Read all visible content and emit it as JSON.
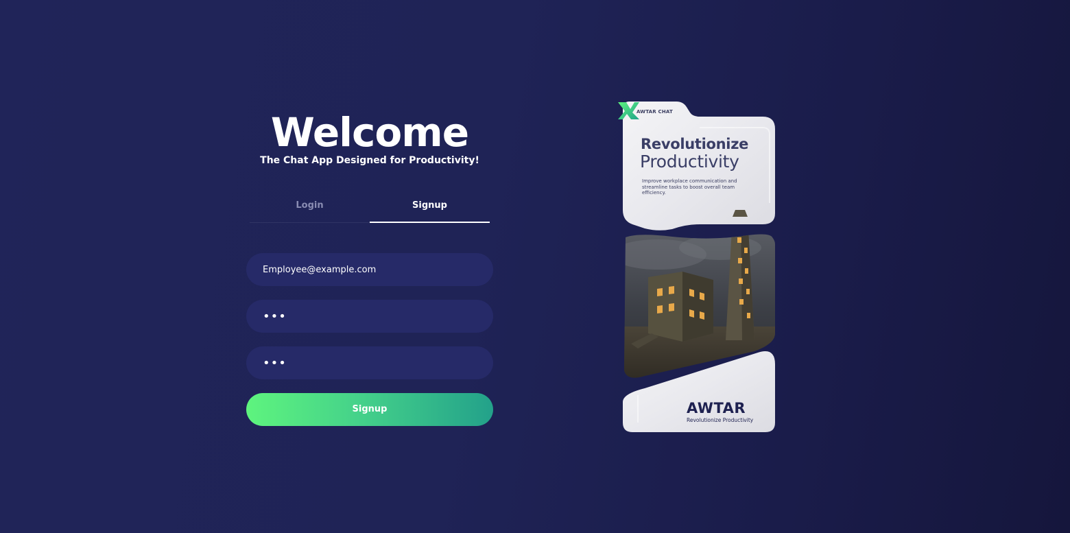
{
  "header": {
    "title": "Welcome",
    "subtitle": "The Chat App Designed for Productivity!"
  },
  "tabs": [
    {
      "label": "Login",
      "active": false
    },
    {
      "label": "Signup",
      "active": true
    }
  ],
  "form": {
    "email_value": "Employee@example.com",
    "password_value": "•••",
    "confirm_password_value": "•••",
    "submit_label": "Signup"
  },
  "promo": {
    "brand_tag": "AWTAR CHAT",
    "headline_bold": "Revolutionize",
    "headline_light": "Productivity",
    "description": "Improve workplace communication and streamline tasks to boost overall team efficiency.",
    "logo_text": "AWTAR",
    "logo_tagline": "Revolutionize Productivity",
    "image_icon": "castle-tower-image"
  },
  "colors": {
    "background": "#1f2356",
    "input_bg": "#262a68",
    "button_start": "#5ef47e",
    "button_end": "#23a18a",
    "tab_inactive": "#8a8db3"
  }
}
